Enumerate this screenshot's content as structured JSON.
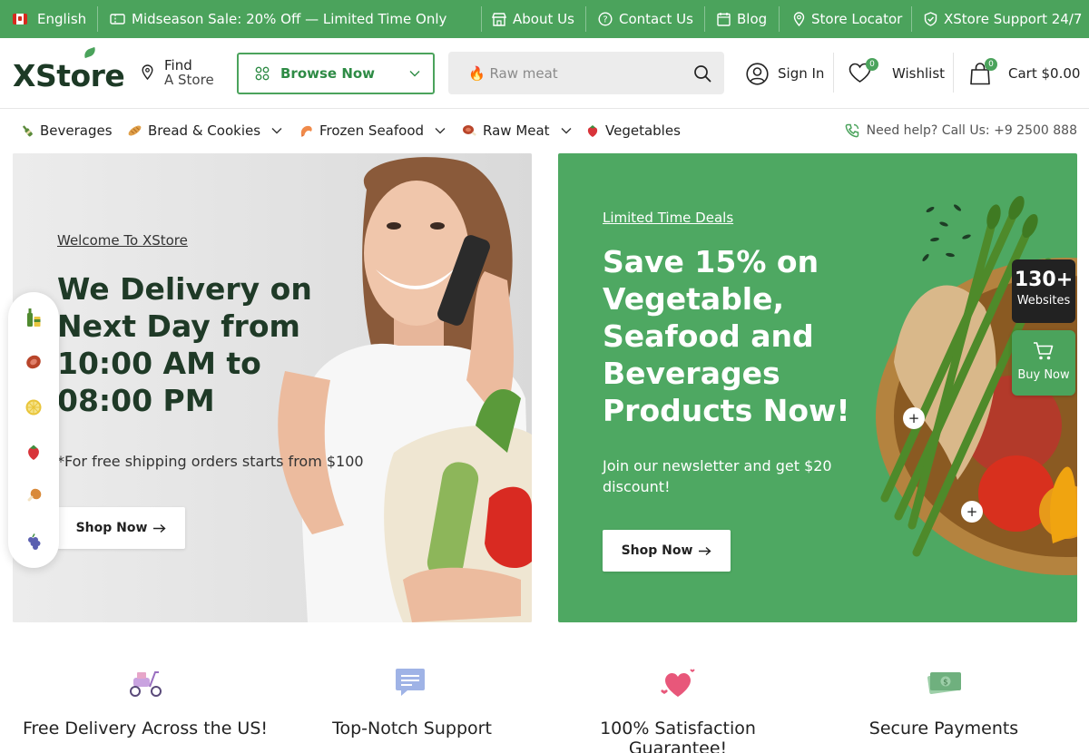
{
  "topbar": {
    "language": "English",
    "promo": "Midseason Sale: 20% Off — Limited Time Only",
    "about": "About Us",
    "contact": "Contact Us",
    "blog": "Blog",
    "locator": "Store Locator",
    "support": "XStore Support 24/7"
  },
  "header": {
    "logo": "XStore",
    "find_line1": "Find",
    "find_line2": "A Store",
    "browse": "Browse Now",
    "search_placeholder": "🔥 Raw meat",
    "signin": "Sign In",
    "wishlist": "Wishlist",
    "wishlist_count": "0",
    "cart": "Cart $0.00",
    "cart_count": "0"
  },
  "categories": [
    {
      "label": "Beverages",
      "icon": "bottle-icon"
    },
    {
      "label": "Bread & Cookies",
      "icon": "bread-icon"
    },
    {
      "label": "Frozen Seafood",
      "icon": "shrimp-icon"
    },
    {
      "label": "Raw Meat",
      "icon": "meat-icon"
    },
    {
      "label": "Vegetables",
      "icon": "strawberry-icon"
    }
  ],
  "help": "Need help? Call Us: +9 2500 888",
  "hero_left": {
    "eyebrow": "Welcome To XStore",
    "title": "We Delivery on Next Day from 10:00 AM to 08:00 PM",
    "note": "*For free shipping orders starts from $100",
    "cta": "Shop Now"
  },
  "hero_right": {
    "eyebrow": "Limited Time Deals",
    "title": "Save 15% on Vegetable, Seafood and Beverages Products Now!",
    "sub": "Join our newsletter and get $20 discount!",
    "cta": "Shop Now"
  },
  "widgets": {
    "websites_count": "130+",
    "websites_label": "Websites",
    "buy_label": "Buy Now"
  },
  "floating_icons": [
    "drinks-icon",
    "meat-icon",
    "lemon-icon",
    "strawberry-icon",
    "chicken-leg-icon",
    "grapes-icon"
  ],
  "features": [
    {
      "title": "Free Delivery Across the US!",
      "icon": "scooter-icon"
    },
    {
      "title": "Top-Notch Support",
      "icon": "chat-icon"
    },
    {
      "title": "100% Satisfaction Guarantee!",
      "icon": "hearts-icon"
    },
    {
      "title": "Secure Payments",
      "icon": "money-icon"
    }
  ],
  "colors": {
    "brand_green": "#4ba35c",
    "dark_green": "#1f3a27",
    "text": "#222222"
  }
}
